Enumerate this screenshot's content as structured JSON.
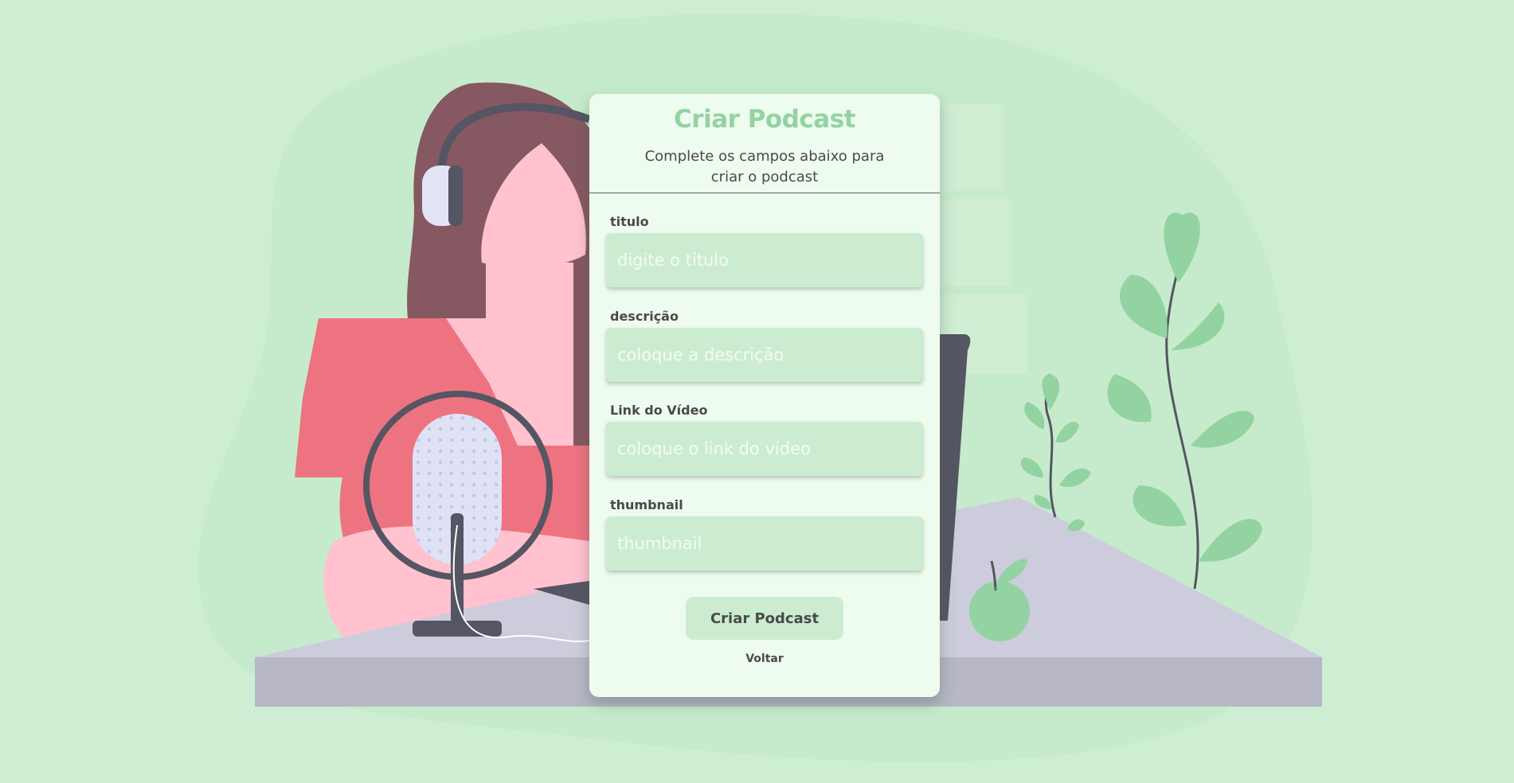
{
  "form": {
    "title": "Criar Podcast",
    "subtitle": "Complete os campos abaixo para criar o podcast",
    "fields": [
      {
        "label": "titulo",
        "value": "",
        "placeholder": "digite o titulo"
      },
      {
        "label": "descrição",
        "value": "",
        "placeholder": "coloque a descrição"
      },
      {
        "label": "Link do Vídeo",
        "value": "",
        "placeholder": "coloque o link do vídeo"
      },
      {
        "label": "thumbnail",
        "value": "",
        "placeholder": "thumbnail"
      }
    ],
    "submit_label": "Criar Podcast",
    "back_label": "Voltar"
  },
  "colors": {
    "background": "#cdeed3",
    "card": "#eefbef",
    "accent": "#93d3a2",
    "input": "#cbecd1",
    "text": "#4a4a4a"
  }
}
